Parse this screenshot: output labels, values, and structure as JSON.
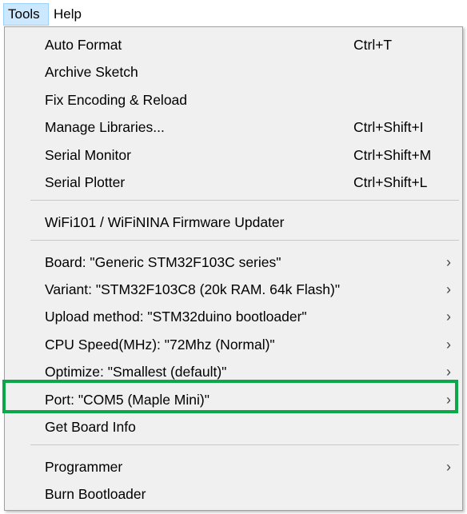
{
  "menubar": {
    "tools": "Tools",
    "help": "Help"
  },
  "menu": {
    "items": [
      {
        "label": "Auto Format",
        "shortcut": "Ctrl+T"
      },
      {
        "label": "Archive Sketch"
      },
      {
        "label": "Fix Encoding & Reload"
      },
      {
        "label": "Manage Libraries...",
        "shortcut": "Ctrl+Shift+I"
      },
      {
        "label": "Serial Monitor",
        "shortcut": "Ctrl+Shift+M"
      },
      {
        "label": "Serial Plotter",
        "shortcut": "Ctrl+Shift+L"
      },
      {
        "label": "WiFi101 / WiFiNINA Firmware Updater"
      },
      {
        "label": "Board: \"Generic STM32F103C series\"",
        "arrow": "›"
      },
      {
        "label": "Variant: \"STM32F103C8 (20k RAM. 64k Flash)\"",
        "arrow": "›"
      },
      {
        "label": "Upload method: \"STM32duino bootloader\"",
        "arrow": "›"
      },
      {
        "label": "CPU Speed(MHz): \"72Mhz (Normal)\"",
        "arrow": "›"
      },
      {
        "label": "Optimize: \"Smallest (default)\"",
        "arrow": "›"
      },
      {
        "label": "Port: \"COM5 (Maple Mini)\"",
        "arrow": "›"
      },
      {
        "label": "Get Board Info"
      },
      {
        "label": "Programmer",
        "arrow": "›"
      },
      {
        "label": "Burn Bootloader"
      }
    ]
  },
  "colors": {
    "highlight_border": "#0aa848",
    "menu_background": "#f0f0f0",
    "active_menu": "#cce8ff"
  }
}
